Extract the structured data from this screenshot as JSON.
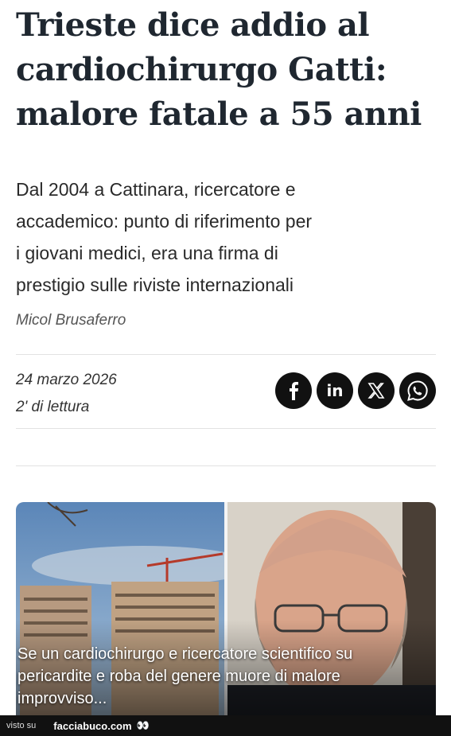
{
  "article": {
    "headline_lines": [
      "Trieste dice addio al",
      "cardiochirurgo Gatti:",
      "malore fatale a 55 anni"
    ],
    "summary_lines": [
      "Dal 2004 a Cattinara, ricercatore e",
      "accademico: punto di riferimento per",
      "i giovani medici, era una firma di",
      "prestigio sulle riviste internazionali"
    ],
    "author": "Micol Brusaferro",
    "date": "24 marzo 2026",
    "reading_time": "2' di lettura"
  },
  "share": {
    "facebook_icon": "facebook-icon",
    "linkedin_label": "in",
    "x_icon": "x-icon",
    "whatsapp_icon": "whatsapp-icon"
  },
  "caption_lines": [
    "Se un cardiochirurgo e ricercatore scientifico su",
    "pericardite e roba del genere muore di malore",
    "improvviso..."
  ],
  "footer": {
    "visto_su": "visto su",
    "site": "facciabuco.com"
  },
  "colors": {
    "headline": "#1f2730",
    "share_button_bg": "#111111",
    "footer_bg": "#111111"
  }
}
